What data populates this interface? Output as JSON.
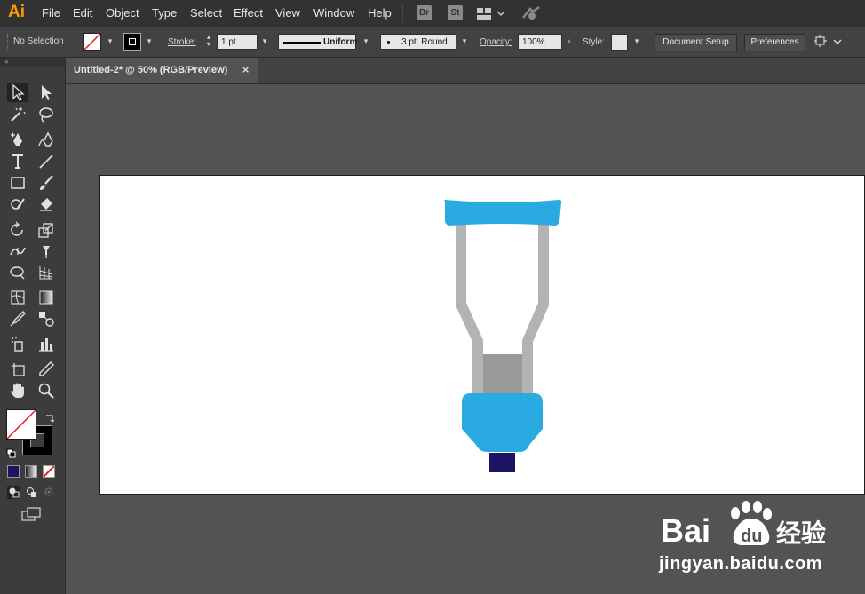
{
  "menubar": {
    "logo": "Ai",
    "items": [
      "File",
      "Edit",
      "Object",
      "Type",
      "Select",
      "Effect",
      "View",
      "Window",
      "Help"
    ],
    "bridge_badge": "Br",
    "stock_badge": "St"
  },
  "controlbar": {
    "selection_status": "No Selection",
    "stroke_label": "Stroke:",
    "stroke_weight": "1 pt",
    "stroke_profile": "Uniform",
    "brush": "3 pt. Round",
    "opacity_label": "Opacity:",
    "opacity_value": "100%",
    "style_label": "Style:",
    "document_setup_label": "Document Setup",
    "preferences_label": "Preferences"
  },
  "tabs": [
    {
      "label": "Untitled-2* @ 50% (RGB/Preview)",
      "close": "×"
    }
  ],
  "colors": {
    "crutch_blue": "#29abe2",
    "crutch_gray_light": "#b3b3b3",
    "crutch_gray_dark": "#999999",
    "crutch_tip": "#1b1464",
    "accent_logo": "#ff9a00"
  },
  "watermark": {
    "brand": "Bai du 经验",
    "url": "jingyan.baidu.com"
  }
}
